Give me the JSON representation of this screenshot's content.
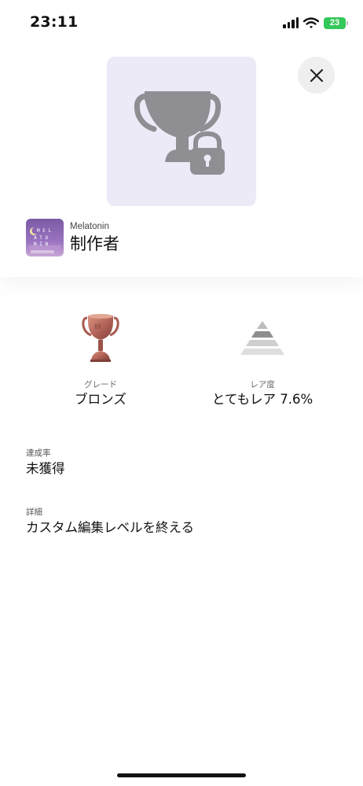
{
  "status_bar": {
    "time": "23:11",
    "battery": "23"
  },
  "header": {
    "trophy_icon": "locked-trophy-icon",
    "close_icon": "close-icon"
  },
  "game": {
    "name": "Melatonin",
    "thumbnail_icon": "game-cover-art",
    "trophy_title": "制作者"
  },
  "stats": {
    "grade": {
      "label": "グレード",
      "value": "ブロンズ",
      "icon": "bronze-trophy-icon"
    },
    "rarity": {
      "label": "レア度",
      "value": "とてもレア 7.6%",
      "icon": "rarity-pyramid-icon"
    }
  },
  "details": {
    "progress": {
      "label": "達成率",
      "value": "未獲得"
    },
    "description": {
      "label": "詳細",
      "value": "カスタム編集レベルを終える"
    }
  },
  "colors": {
    "card_bg": "#eceaf7",
    "trophy_gray": "#8e8e93",
    "bronze": "#b5655a",
    "battery_green": "#34c759"
  }
}
